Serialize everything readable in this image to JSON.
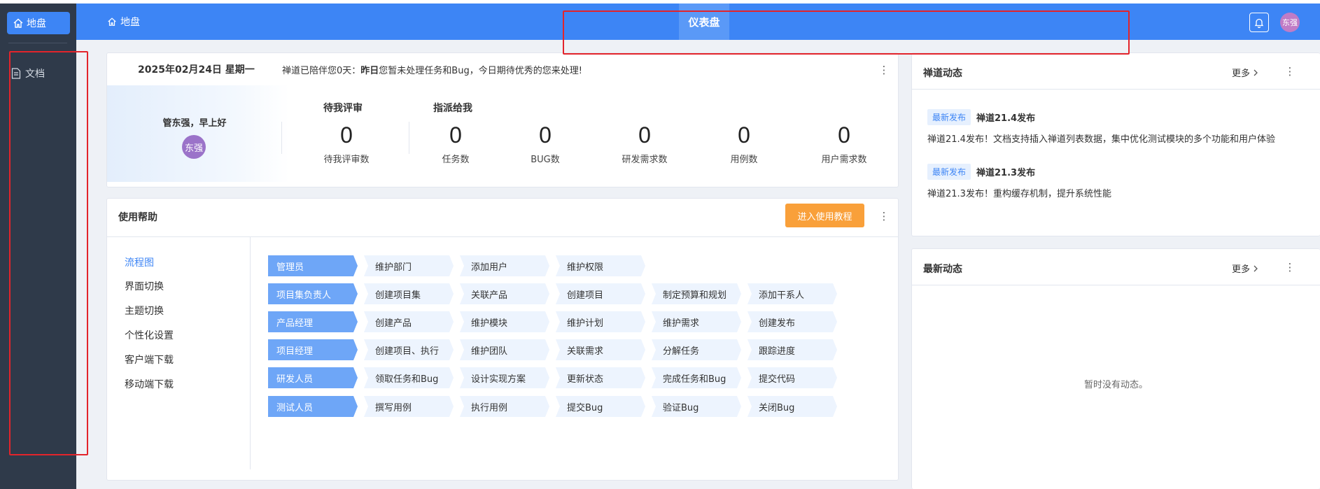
{
  "sidebar": {
    "home_label": "地盘",
    "doc_label": "文档"
  },
  "header": {
    "breadcrumb": "地盘",
    "center_tab": "仪表盘",
    "avatar_text": "东强"
  },
  "welcome": {
    "date": "2025年02月24日 星期一",
    "message_prefix": "禅道已陪伴您0天：",
    "message_bold": "昨日",
    "message_suffix": "您暂未处理任务和Bug，今日期待优秀的您来处理!",
    "greeting": "管东强，早上好",
    "avatar_text": "东强",
    "group_review": "待我评审",
    "group_assigned": "指派给我",
    "stats": [
      {
        "value": "0",
        "label": "待我评审数"
      },
      {
        "value": "0",
        "label": "任务数"
      },
      {
        "value": "0",
        "label": "BUG数"
      },
      {
        "value": "0",
        "label": "研发需求数"
      },
      {
        "value": "0",
        "label": "用例数"
      },
      {
        "value": "0",
        "label": "用户需求数"
      }
    ]
  },
  "help": {
    "title": "使用帮助",
    "tutorial_button": "进入使用教程",
    "menu": [
      "流程图",
      "界面切换",
      "主题切换",
      "个性化设置",
      "客户端下载",
      "移动端下载"
    ],
    "flow": [
      {
        "role": "管理员",
        "steps": [
          "维护部门",
          "添加用户",
          "维护权限"
        ]
      },
      {
        "role": "项目集负责人",
        "steps": [
          "创建项目集",
          "关联产品",
          "创建项目",
          "制定预算和规划",
          "添加干系人"
        ]
      },
      {
        "role": "产品经理",
        "steps": [
          "创建产品",
          "维护模块",
          "维护计划",
          "维护需求",
          "创建发布"
        ]
      },
      {
        "role": "项目经理",
        "steps": [
          "创建项目、执行",
          "维护团队",
          "关联需求",
          "分解任务",
          "跟踪进度"
        ]
      },
      {
        "role": "研发人员",
        "steps": [
          "领取任务和Bug",
          "设计实现方案",
          "更新状态",
          "完成任务和Bug",
          "提交代码"
        ]
      },
      {
        "role": "测试人员",
        "steps": [
          "撰写用例",
          "执行用例",
          "提交Bug",
          "验证Bug",
          "关闭Bug"
        ]
      }
    ]
  },
  "zentao_news": {
    "title": "禅道动态",
    "more": "更多",
    "items": [
      {
        "tag": "最新发布",
        "title": "禅道21.4发布",
        "desc": "禅道21.4发布！文档支持插入禅道列表数据，集中优化测试模块的多个功能和用户体验"
      },
      {
        "tag": "最新发布",
        "title": "禅道21.3发布",
        "desc": "禅道21.3发布！重构缓存机制，提升系统性能"
      }
    ]
  },
  "latest": {
    "title": "最新动态",
    "more": "更多",
    "empty": "暂时没有动态。"
  },
  "icons": {
    "home": "home-icon",
    "doc": "document-icon",
    "bell": "bell-icon",
    "more": "more-vertical-icon",
    "chevron": "chevron-right-icon"
  },
  "colors": {
    "primary": "#3d85f5",
    "sidebar": "#2f3a4a",
    "tutorial": "#f9a03a",
    "annotation": "#e3242b"
  }
}
